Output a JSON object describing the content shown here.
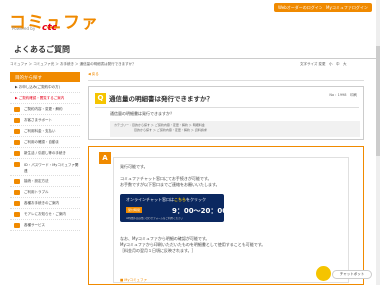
{
  "header": {
    "logo": "コミュファ",
    "logo_tagline": "Powered by",
    "logo_brand": "ctc",
    "web_button": "Webオーダーのログイン",
    "my_button": "Myコミュファログイン",
    "page_title": "よくあるご質問"
  },
  "breadcrumb": {
    "path": "コミュファ ＞ コミュファ光 ＞ お手続き ＞ 通信量の明細書は発行できますか？",
    "right": "文字サイズ 変更　小　中　大"
  },
  "sidebar": {
    "heading": "目的から探す",
    "items": [
      {
        "label": "▶ お申し込み(ご契約中の方)",
        "style": "sub",
        "active": false
      },
      {
        "label": "▶ ご契約確認・閲覧するご案内",
        "style": "sub",
        "active": true
      },
      {
        "label": "ご契約内容・変更・解約",
        "style": "icon",
        "active": false
      },
      {
        "label": "お客さまサポート",
        "style": "icon",
        "active": false
      },
      {
        "label": "ご利用料金・支払い",
        "style": "icon",
        "active": false
      },
      {
        "label": "ご利用の確認・自動ま",
        "style": "icon",
        "active": false
      },
      {
        "label": "新生活 / 引越し等の手続き",
        "style": "icon",
        "active": false
      },
      {
        "label": "ID・パスワード・Myコミュファ関連",
        "style": "icon",
        "active": false
      },
      {
        "label": "接続・設定方法",
        "style": "icon",
        "active": false
      },
      {
        "label": "ご利用トラブル",
        "style": "icon",
        "active": false
      },
      {
        "label": "各種お手続きのご案内",
        "style": "icon",
        "active": false
      },
      {
        "label": "モアレにお知らせ・ご案内",
        "style": "icon",
        "active": false
      },
      {
        "label": "各種サービス",
        "style": "icon",
        "active": false
      }
    ]
  },
  "main": {
    "back_label": "◀ 戻る",
    "question": {
      "badge": "Q",
      "title": "通信量の明細書は発行できますか？",
      "number": "No : 1998　印刷",
      "sub": "通信量の明細書は発行できますか？",
      "category_label": "カテゴリー :",
      "category_line1": "目的から探す ＞ ご契約内容・変更・解約 ＞ 明細料金",
      "category_line2": "目的から探す ＞ ご契約内容・変更・解約 ＞ 資料請求"
    },
    "answer": {
      "badge": "A",
      "line1": "発行可能です。",
      "line2": "コミュファチャット窓口にてお手続きが可能です。",
      "line3": "お手数ですが以下窓口までご連絡をお願いいたします。",
      "chat_title_prefix": "オンラインチャット窓口は",
      "chat_title_emph": "こちら",
      "chat_title_suffix": "をクリック",
      "chat_hours_label": "受付時間",
      "chat_hours": "9：00～20：00（年中無休）",
      "chat_note": "※時間外はお問い合わせフォームをご利用ください",
      "line4": "なお、Myコミュファから明細の確認が可能です。",
      "line5": "Myコミュファから印刷いただいたものを明細書として使用することも可能です。",
      "line6": "［料金月の翌月１日頃に反映されます。］",
      "mylink": "■ Myコミュファ"
    }
  },
  "chatbot": {
    "bubble": "チャットボット"
  }
}
